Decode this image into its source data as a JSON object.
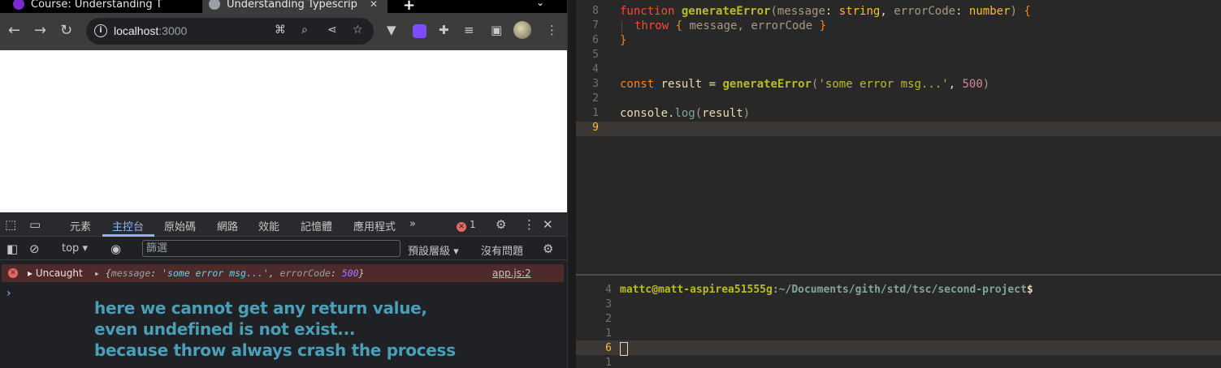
{
  "browser": {
    "tabs": [
      {
        "title": "Course: Understanding T"
      },
      {
        "title": "Understanding Typescrip"
      }
    ],
    "new_tab": "+",
    "url_host": "localhost",
    "url_port": ":3000"
  },
  "devtools": {
    "tabs": [
      "元素",
      "主控台",
      "原始碼",
      "網路",
      "效能",
      "記憶體",
      "應用程式"
    ],
    "more": "»",
    "error_count": "1",
    "context": "top",
    "filter_placeholder": "篩選",
    "levels": "預設層級",
    "no_issues": "沒有問題",
    "error": {
      "label": "Uncaught",
      "object_open": "{",
      "key1": "message",
      "val1": "'some error msg...'",
      "key2": "errorCode",
      "val2": "500",
      "object_close": "}",
      "source": "app.js:2"
    },
    "prompt": "›",
    "note": [
      "here we cannot get any return value,",
      "even undefined is not exist...",
      "because throw always crash the process"
    ]
  },
  "editor": {
    "line_numbers": [
      "8",
      "7",
      "6",
      "5",
      "4",
      "3",
      "2",
      "1",
      "9"
    ],
    "lines": {
      "l1_kw": "function",
      "l1_fn": "generateError",
      "l1_p1": "message",
      "l1_t1": "string",
      "l1_p2": "errorCode",
      "l1_t2": "number",
      "l2_kw": "throw",
      "l2_obj": "message, errorCode",
      "l6_kw": "const",
      "l6_var": "result",
      "l6_fn": "generateError",
      "l6_str": "'some error msg...'",
      "l6_num": "500",
      "l8_obj": "console",
      "l8_fn": "log",
      "l8_arg": "result"
    }
  },
  "terminal": {
    "line_numbers": [
      "4",
      "3",
      "2",
      "1",
      "6",
      "1"
    ],
    "user": "mattc@matt-aspirea51555g",
    "path": ":~/Documents/gith/std/tsc/second-project",
    "dollar": "$"
  }
}
